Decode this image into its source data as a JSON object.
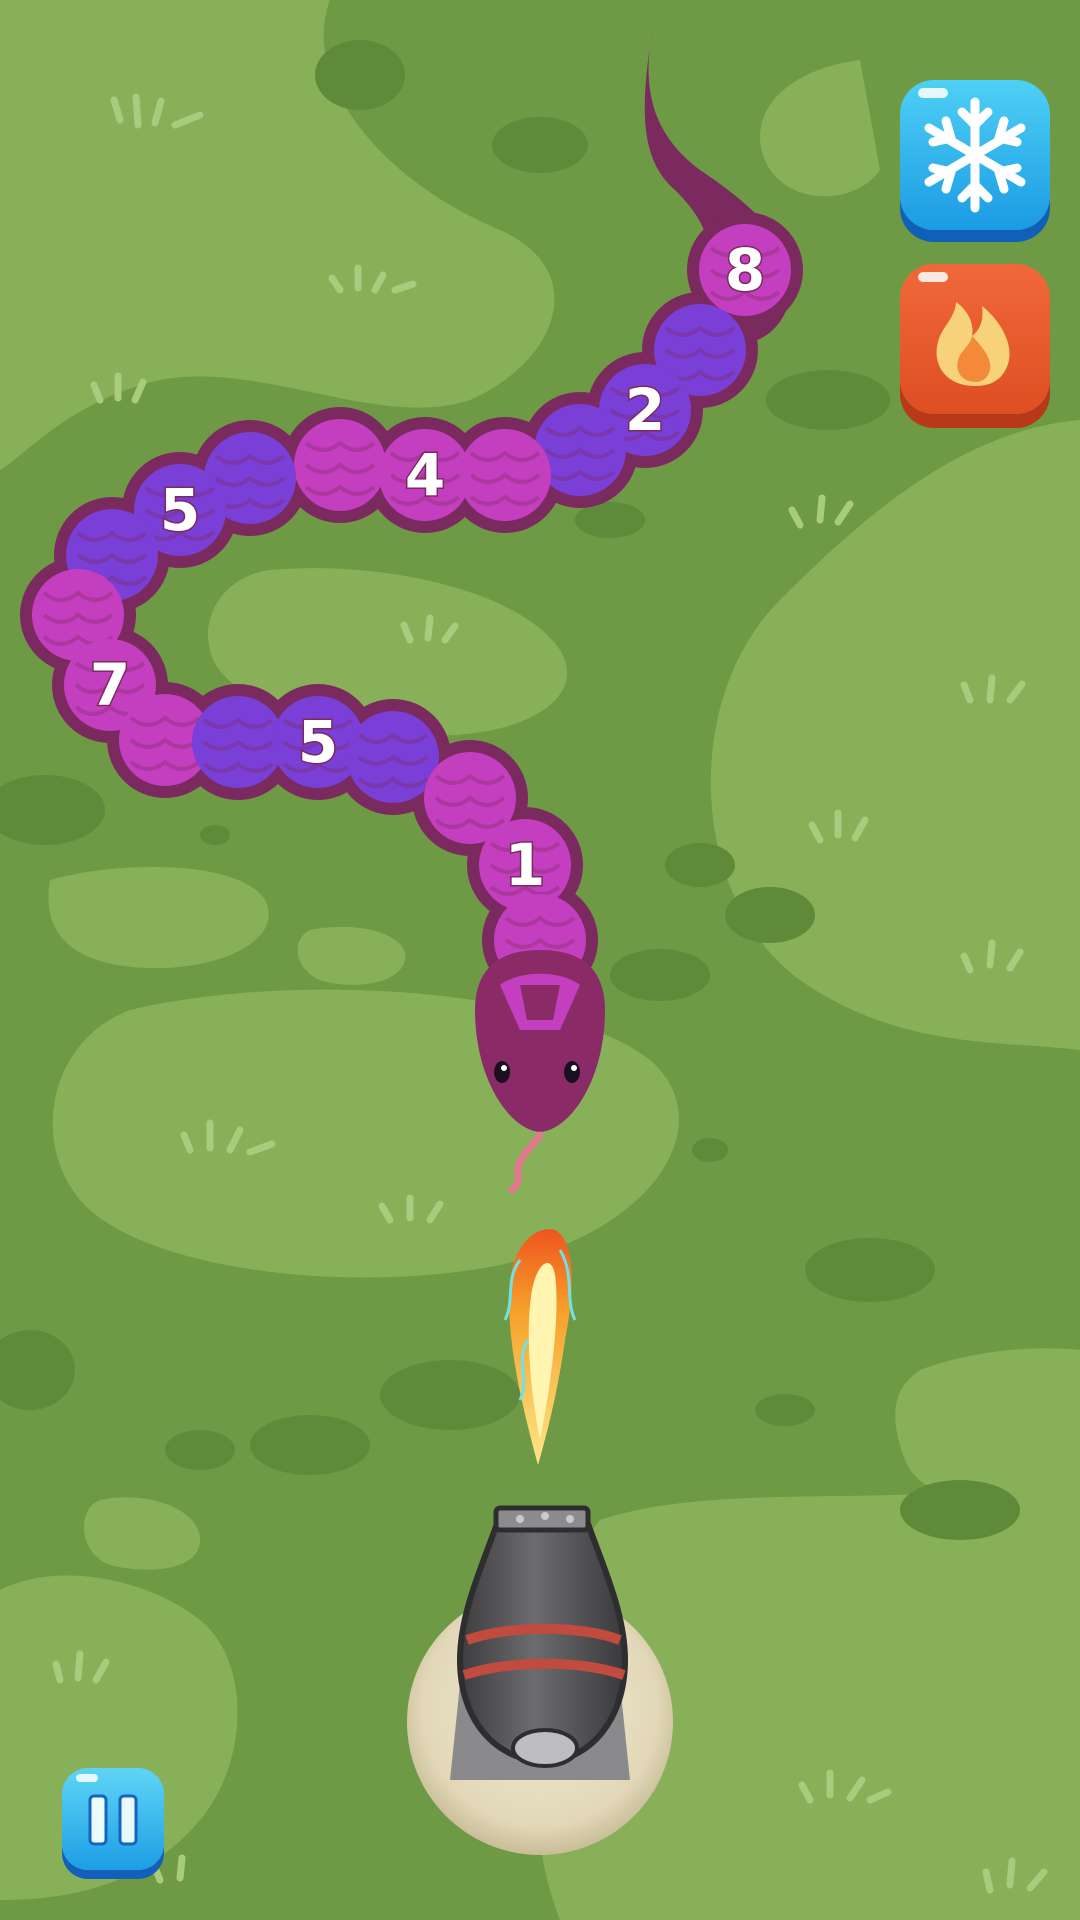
{
  "segment_numbers": [
    "8",
    "2",
    "4",
    "5",
    "7",
    "5",
    "1"
  ],
  "powerups": {
    "freeze": {
      "icon": "snowflake-icon"
    },
    "fire": {
      "icon": "flame-icon"
    }
  },
  "pause": {
    "icon": "pause-icon"
  },
  "colors": {
    "grass_dark": "#6f9a45",
    "grass_light": "#87b059",
    "snake_pink": "#c43fc0",
    "snake_purple": "#7a3fd6",
    "snake_dark": "#7a2a5e",
    "freeze_blue": "#1b9be3",
    "fire_orange": "#e2532a"
  }
}
